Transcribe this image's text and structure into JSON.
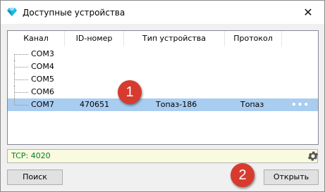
{
  "window": {
    "title": "Доступные устройства",
    "icon": "diamond-icon",
    "close_glyph": "✕"
  },
  "table": {
    "columns": [
      "Канал",
      "ID-номер",
      "Тип устройства",
      "Протокол"
    ],
    "rows": [
      {
        "channel": "COM3",
        "id": "",
        "type": "",
        "protocol": "",
        "selected": false
      },
      {
        "channel": "COM4",
        "id": "",
        "type": "",
        "protocol": "",
        "selected": false
      },
      {
        "channel": "COM5",
        "id": "",
        "type": "",
        "protocol": "",
        "selected": false
      },
      {
        "channel": "COM6",
        "id": "",
        "type": "",
        "protocol": "",
        "selected": false
      },
      {
        "channel": "COM7",
        "id": "470651",
        "type": "Топаз-186",
        "protocol": "Топаз",
        "selected": true
      }
    ],
    "row_more": "•••"
  },
  "status": {
    "text": "TCP: 4020",
    "settings_icon": "gear-icon"
  },
  "buttons": {
    "search": "Поиск",
    "open": "Открыть"
  },
  "callouts": [
    "1",
    "2"
  ],
  "colors": {
    "selection": "#a9cdf0",
    "status_bg": "#fafae0",
    "status_text": "#0a7d26",
    "callout": "#d73b2f",
    "icon_accent": "#1fb7e6"
  }
}
